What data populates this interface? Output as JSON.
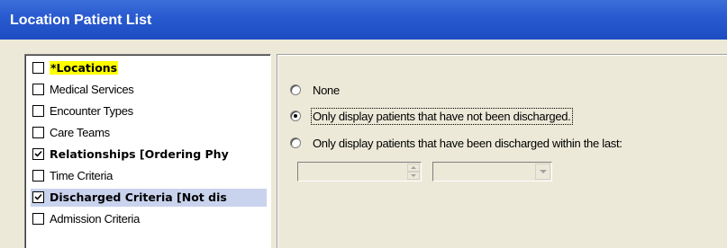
{
  "window": {
    "title": "Location Patient List"
  },
  "criteria_list": {
    "items": [
      {
        "label": "*Locations",
        "checked": false,
        "bold": true,
        "highlight": true,
        "selected": false
      },
      {
        "label": "Medical Services",
        "checked": false,
        "bold": false,
        "highlight": false,
        "selected": false
      },
      {
        "label": "Encounter Types",
        "checked": false,
        "bold": false,
        "highlight": false,
        "selected": false
      },
      {
        "label": "Care Teams",
        "checked": false,
        "bold": false,
        "highlight": false,
        "selected": false
      },
      {
        "label": "Relationships [Ordering Phy",
        "checked": true,
        "bold": true,
        "highlight": false,
        "selected": false
      },
      {
        "label": "Time Criteria",
        "checked": false,
        "bold": false,
        "highlight": false,
        "selected": false
      },
      {
        "label": "Discharged Criteria [Not dis",
        "checked": true,
        "bold": true,
        "highlight": false,
        "selected": true
      },
      {
        "label": "Admission Criteria",
        "checked": false,
        "bold": false,
        "highlight": false,
        "selected": false
      }
    ]
  },
  "discharge_options": {
    "none_label": "None",
    "not_discharged_label": "Only display patients that have not been discharged.",
    "discharged_within_label": "Only display patients that have been discharged within the last:",
    "selected": "not_discharged",
    "quantity_value": "",
    "unit_value": ""
  },
  "colors": {
    "titlebar": "#2a5bd0",
    "highlight": "#ffff00",
    "selection": "#c9d3ee",
    "dialog_bg": "#ece9d8"
  }
}
